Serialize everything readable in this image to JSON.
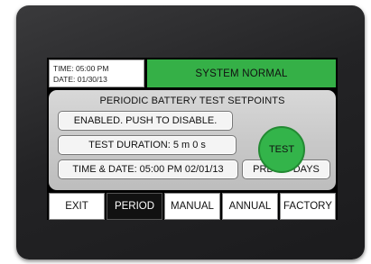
{
  "info": {
    "time": "TIME: 05:00  PM",
    "date": "DATE:  01/30/13"
  },
  "status": {
    "text": "SYSTEM NORMAL",
    "color": "#35b047"
  },
  "panel": {
    "title": "PERIODIC BATTERY TEST SETPOINTS",
    "enabled_button": "ENABLED. PUSH TO DISABLE.",
    "test_duration": "TEST DURATION: 5 m 0 s",
    "time_date": "TIME & DATE: 05:00 PM 02/01/13",
    "period": "PRD: 30 DAYS",
    "test_button": "TEST",
    "test_button_color": "#33b44a"
  },
  "nav": {
    "exit": "EXIT",
    "period": "PERIOD",
    "manual": "MANUAL",
    "annual": "ANNUAL",
    "factory": "FACTORY",
    "active": "PERIOD"
  }
}
